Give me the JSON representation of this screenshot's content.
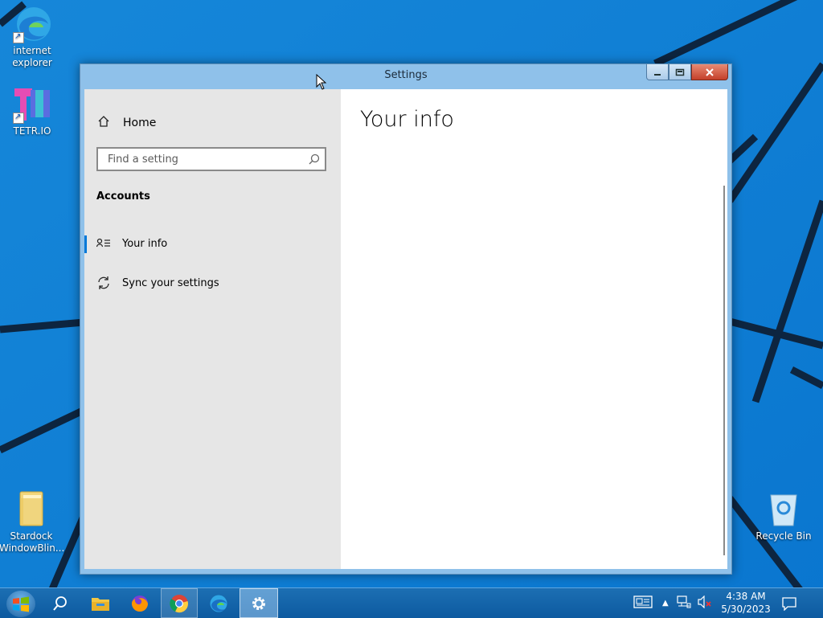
{
  "desktop": {
    "icons": [
      {
        "label_line1": "internet",
        "label_line2": "explorer"
      },
      {
        "label_line1": "TETR.IO",
        "label_line2": ""
      },
      {
        "label_line1": "Stardock",
        "label_line2": "WindowBlin..."
      },
      {
        "label_line1": "Recycle Bin",
        "label_line2": ""
      }
    ]
  },
  "window": {
    "title": "Settings",
    "sidebar": {
      "home_label": "Home",
      "search_placeholder": "Find a setting",
      "section_title": "Accounts",
      "items": [
        {
          "label": "Your info",
          "active": true
        },
        {
          "label": "Sync your settings",
          "active": false
        }
      ]
    },
    "content": {
      "page_title": "Your info"
    }
  },
  "taskbar": {
    "apps": [
      "search-icon",
      "file-explorer-icon",
      "firefox-icon",
      "chrome-icon",
      "edge-icon",
      "settings-gear-icon"
    ],
    "clock": {
      "time": "4:38 AM",
      "date": "5/30/2023"
    }
  },
  "colors": {
    "accent": "#0078d7",
    "sidebar_bg": "#e6e6e6",
    "taskbar": "#0d5aa0"
  }
}
